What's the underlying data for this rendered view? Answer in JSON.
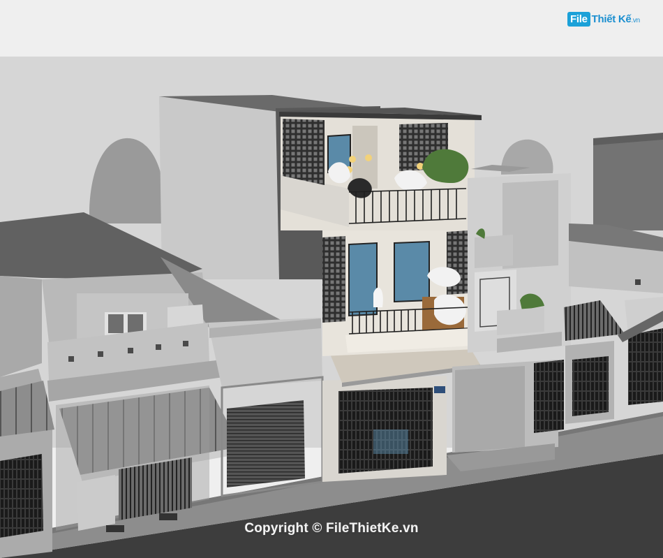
{
  "logo": {
    "badge": "File",
    "name": "Thiết Kế",
    "domain": ".vn",
    "brand_color": "#1ba1d8"
  },
  "watermark": {
    "text": "Copyright © FileThietKe.vn"
  },
  "house_number_plate": {
    "text": ""
  },
  "colors": {
    "sky": "#efefef",
    "background_wall": "#d4d4d4",
    "road": "#3e3e3e",
    "sidewalk": "#8a8a8a",
    "window_glass": "#5a8aa8",
    "wood_accent": "#9a6a3a",
    "plant_green": "#4f7a3a"
  }
}
